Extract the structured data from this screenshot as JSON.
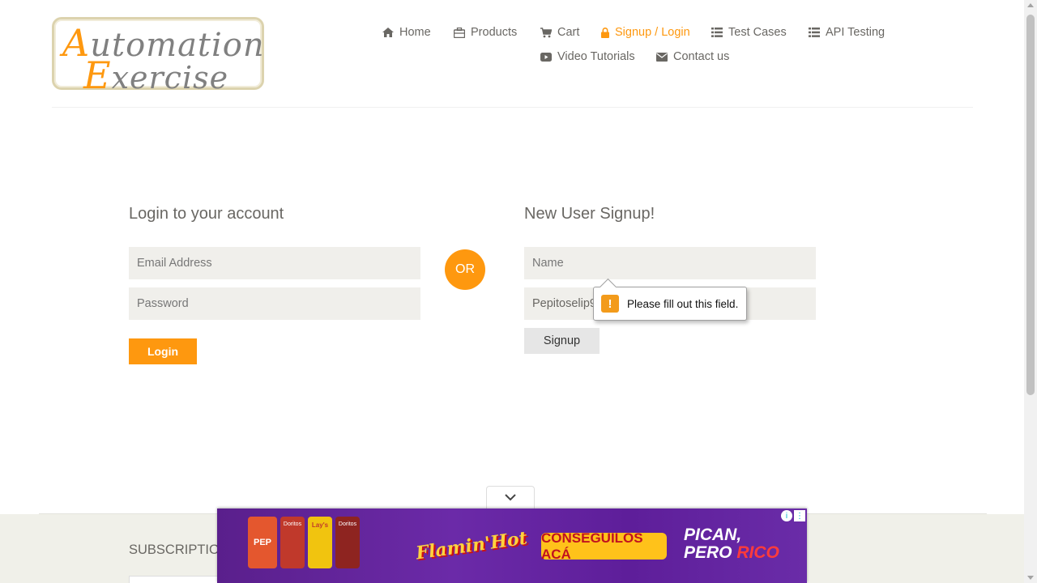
{
  "logo": {
    "line1_cap": "A",
    "line1_rest": "utomation",
    "line2_cap": "E",
    "line2_rest": "xercise"
  },
  "nav": {
    "items": [
      {
        "label": "Home",
        "icon": "home-icon"
      },
      {
        "label": "Products",
        "icon": "products-icon"
      },
      {
        "label": "Cart",
        "icon": "cart-icon"
      },
      {
        "label": "Signup / Login",
        "icon": "lock-icon",
        "active": true
      },
      {
        "label": "Test Cases",
        "icon": "list-icon"
      },
      {
        "label": "API Testing",
        "icon": "list-icon"
      },
      {
        "label": "Video Tutorials",
        "icon": "youtube-play-icon"
      },
      {
        "label": "Contact us",
        "icon": "envelope-icon"
      }
    ]
  },
  "login": {
    "title": "Login to your account",
    "email_placeholder": "Email Address",
    "password_placeholder": "Password",
    "button": "Login"
  },
  "or_label": "OR",
  "signup": {
    "title": "New User Signup!",
    "name_placeholder": "Name",
    "email_value": "Pepitoselip9",
    "button": "Signup"
  },
  "validation_tooltip": {
    "icon": "warning-icon",
    "message": "Please fill out this field."
  },
  "footer": {
    "subscription_heading": "SUBSCRIPTION"
  },
  "ad": {
    "bag_labels": [
      "PEP",
      "Doritos",
      "Lay's",
      "Doritos"
    ],
    "brand": "Flamin'Hot",
    "cta": "CONSEGUILOS ACÁ",
    "slogan_line1": "PICAN,",
    "slogan_line2_a": "PERO ",
    "slogan_line2_b": "RICO"
  },
  "colors": {
    "accent": "#fe980f",
    "field_bg": "#f0efeb",
    "text": "#696763",
    "footer_bg": "#f0f0e9"
  }
}
